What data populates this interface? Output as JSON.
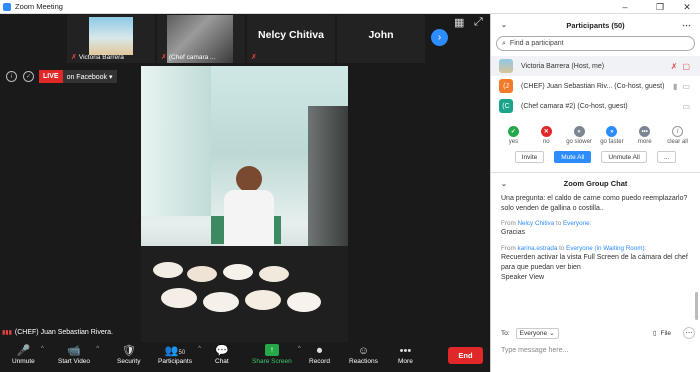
{
  "window": {
    "title": "Zoom Meeting",
    "controls": [
      "–",
      "❐",
      "✕"
    ]
  },
  "strip": {
    "participants": [
      {
        "name": "Victoria Barrera",
        "muted": true
      },
      {
        "name": "(Chef camara ...",
        "muted": true
      },
      {
        "name": "Nelcy Chitiva",
        "muted": true
      },
      {
        "name": "John",
        "muted": false
      }
    ],
    "next_icon": "chevron-right-icon"
  },
  "live": {
    "tag": "LIVE",
    "platform": "on Facebook ▾"
  },
  "speaker": {
    "name": "(CHEF) Juan Sebastian Rivera."
  },
  "toolbar": {
    "items": [
      {
        "label": "Unmute",
        "icon": "🎤",
        "caret": true
      },
      {
        "label": "Start Video",
        "icon": "📹",
        "caret": true
      },
      {
        "label": "Security",
        "icon": "🛡",
        "caret": false
      },
      {
        "label": "Participants",
        "icon": "👥",
        "count": "50",
        "caret": true
      },
      {
        "label": "Chat",
        "icon": "💬",
        "caret": false
      },
      {
        "label": "Share Screen",
        "icon": "↑",
        "caret": true
      },
      {
        "label": "Record",
        "icon": "⏺",
        "caret": false
      },
      {
        "label": "Reactions",
        "icon": "☺",
        "caret": false
      },
      {
        "label": "More",
        "icon": "•••",
        "caret": false
      }
    ],
    "end_label": "End"
  },
  "participants_panel": {
    "title": "Participants (50)",
    "search_placeholder": "Find a participant",
    "list": [
      {
        "name": "Victoria Barrera (Host, me)",
        "avatar_text": "",
        "avatar_color": "#6aa6c8"
      },
      {
        "name": "(CHEF) Juan Sebastian Riv...  (Co-host, guest)",
        "avatar_text": "(J",
        "avatar_color": "#f27a2b"
      },
      {
        "name": "(Chef camara #2) (Co-host, guest)",
        "avatar_text": "(C",
        "avatar_color": "#1aa58a"
      }
    ],
    "reactions": [
      {
        "label": "yes",
        "symbol": "✓",
        "color": "#26a74a"
      },
      {
        "label": "no",
        "symbol": "✕",
        "color": "#e02828"
      },
      {
        "label": "go slower",
        "symbol": "«",
        "color": "#7c8592"
      },
      {
        "label": "go faster",
        "symbol": "»",
        "color": "#2d8cff"
      },
      {
        "label": "more",
        "symbol": "•••",
        "color": "#7c8592"
      },
      {
        "label": "clear all",
        "symbol": "",
        "color": "#999999"
      }
    ],
    "buttons": [
      "Invite",
      "Mute All",
      "Unmute All",
      "..."
    ]
  },
  "chat": {
    "title": "Zoom Group Chat",
    "messages": [
      {
        "meta_from": "",
        "meta_to": "",
        "text": "Una pregunta: el caldo de carne como puedo reemplazarlo? solo venden de gallina o costilla.."
      },
      {
        "meta_from": "Nelcy Chitiva",
        "meta_to": "Everyone",
        "text": "Gracias"
      },
      {
        "meta_from": "karina.estrada",
        "meta_to": "Everyone (in Waiting Room)",
        "text": "Recuerden activar la vista Full Screen de la cámara del chef para que puedan ver bien\nSpeaker View"
      }
    ],
    "from_prefix": "From",
    "to_word": "to",
    "to_label": "To:",
    "to_value": "Everyone",
    "file_label": "File",
    "input_placeholder": "Type message here..."
  }
}
